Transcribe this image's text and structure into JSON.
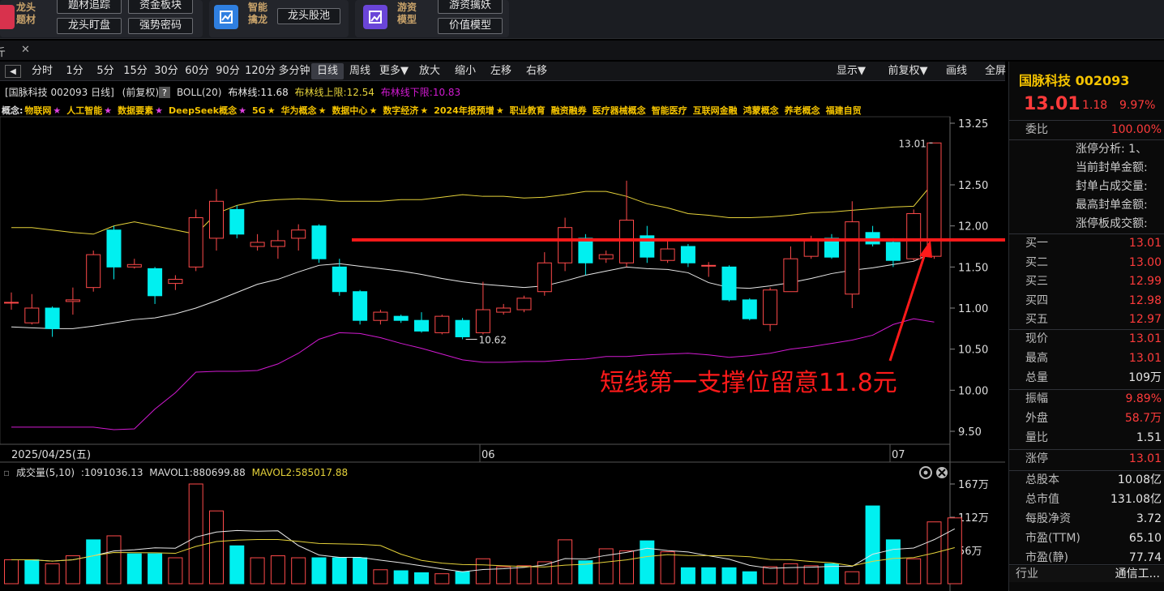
{
  "toolbar": {
    "group1": {
      "label": "龙头题材",
      "buttons": [
        "题材追踪",
        "资金板块",
        "龙头盯盘",
        "强势密码"
      ]
    },
    "group2": {
      "label": "智能擒龙",
      "buttons": [
        "龙头股池"
      ]
    },
    "group3": {
      "label": "游资模型",
      "buttons": [
        "游资擒妖",
        "价值模型"
      ]
    }
  },
  "tab": {
    "title": "斤",
    "close": "✕"
  },
  "periods": {
    "toggle": "◀",
    "items": [
      "分时",
      "1分",
      "5分",
      "15分",
      "30分",
      "60分",
      "90分",
      "120分",
      "多分钟",
      "日线",
      "周线",
      "更多▼",
      "放大",
      "缩小",
      "左移",
      "右移"
    ],
    "active": "日线",
    "right_items": [
      "显示▼",
      "前复权▼",
      "画线",
      "全屏"
    ]
  },
  "chart_header": {
    "stock_label": "[国脉科技 002093 日线]",
    "adjust": "(前复权)",
    "help": "?",
    "indicator": "BOLL(20)",
    "mid": "布林线:11.68",
    "upper": "布林线上限:12.54",
    "lower": "布林线下限:10.83"
  },
  "concepts": {
    "prefix": "概念:",
    "items": [
      {
        "text": "物联网",
        "star": "pink"
      },
      {
        "text": "人工智能",
        "star": "pink"
      },
      {
        "text": "数据要素",
        "star": "pink"
      },
      {
        "text": "DeepSeek概念",
        "star": "pink"
      },
      {
        "text": "5G",
        "star": "gold"
      },
      {
        "text": "华为概念",
        "star": "gold"
      },
      {
        "text": "数据中心",
        "star": "gold"
      },
      {
        "text": "数字经济",
        "star": "gold"
      },
      {
        "text": "2024年报预增",
        "star": "gold"
      },
      {
        "text": "职业教育",
        "star": ""
      },
      {
        "text": "融资融券",
        "star": ""
      },
      {
        "text": "医疗器械概念",
        "star": ""
      },
      {
        "text": "智能医疗",
        "star": ""
      },
      {
        "text": "互联网金融",
        "star": ""
      },
      {
        "text": "鸿蒙概念",
        "star": ""
      },
      {
        "text": "养老概念",
        "star": ""
      },
      {
        "text": "福建自贸",
        "star": ""
      }
    ]
  },
  "price_axis": [
    "13.25",
    "12.50",
    "12.00",
    "11.50",
    "11.00",
    "10.50",
    "10.00",
    "9.50"
  ],
  "date_axis": [
    "2025/04/25(五)",
    "06",
    "07"
  ],
  "annotations": {
    "high_label": "13.01",
    "low_label": "10.62",
    "support_text": "短线第一支撑位留意11.8元"
  },
  "volume_header": {
    "title": "成交量(5,10)",
    "vol": ":1091036.13",
    "mavol1": "MAVOL1:880699.88",
    "mavol2": "MAVOL2:585017.88"
  },
  "volume_axis": [
    "167万",
    "112万",
    "56万"
  ],
  "chart_data": {
    "type": "candlestick",
    "ylim": [
      9.4,
      13.4
    ],
    "support_level": 11.8,
    "candles": [
      {
        "o": 11.07,
        "c": 11.07,
        "h": 11.19,
        "l": 10.98
      },
      {
        "o": 10.82,
        "c": 11.0,
        "h": 11.17,
        "l": 10.8
      },
      {
        "o": 11.0,
        "c": 10.75,
        "h": 11.02,
        "l": 10.65
      },
      {
        "o": 11.08,
        "c": 11.1,
        "h": 11.25,
        "l": 10.92
      },
      {
        "o": 11.25,
        "c": 11.65,
        "h": 11.7,
        "l": 11.2
      },
      {
        "o": 11.95,
        "c": 11.5,
        "h": 12.0,
        "l": 11.35
      },
      {
        "o": 11.5,
        "c": 11.53,
        "h": 11.6,
        "l": 11.48
      },
      {
        "o": 11.48,
        "c": 11.15,
        "h": 11.5,
        "l": 11.05
      },
      {
        "o": 11.3,
        "c": 11.35,
        "h": 11.4,
        "l": 11.22
      },
      {
        "o": 11.5,
        "c": 12.1,
        "h": 12.2,
        "l": 11.45
      },
      {
        "o": 11.85,
        "c": 12.3,
        "h": 12.45,
        "l": 11.7
      },
      {
        "o": 12.2,
        "c": 11.9,
        "h": 12.25,
        "l": 11.85
      },
      {
        "o": 11.75,
        "c": 11.8,
        "h": 11.9,
        "l": 11.7
      },
      {
        "o": 11.75,
        "c": 11.82,
        "h": 11.95,
        "l": 11.6
      },
      {
        "o": 11.85,
        "c": 11.95,
        "h": 12.02,
        "l": 11.7
      },
      {
        "o": 12.0,
        "c": 11.6,
        "h": 12.02,
        "l": 11.55
      },
      {
        "o": 11.5,
        "c": 11.2,
        "h": 11.6,
        "l": 11.15
      },
      {
        "o": 11.2,
        "c": 10.85,
        "h": 11.22,
        "l": 10.8
      },
      {
        "o": 10.85,
        "c": 10.95,
        "h": 10.98,
        "l": 10.8
      },
      {
        "o": 10.9,
        "c": 10.85,
        "h": 10.92,
        "l": 10.82
      },
      {
        "o": 10.85,
        "c": 10.72,
        "h": 10.95,
        "l": 10.7
      },
      {
        "o": 10.7,
        "c": 10.9,
        "h": 10.92,
        "l": 10.68
      },
      {
        "o": 10.85,
        "c": 10.65,
        "h": 10.88,
        "l": 10.62
      },
      {
        "o": 10.7,
        "c": 10.98,
        "h": 11.32,
        "l": 10.68
      },
      {
        "o": 10.95,
        "c": 11.0,
        "h": 11.05,
        "l": 10.92
      },
      {
        "o": 10.98,
        "c": 11.12,
        "h": 11.15,
        "l": 10.95
      },
      {
        "o": 11.2,
        "c": 11.55,
        "h": 11.68,
        "l": 11.15
      },
      {
        "o": 11.55,
        "c": 11.98,
        "h": 12.1,
        "l": 11.45
      },
      {
        "o": 11.85,
        "c": 11.55,
        "h": 11.9,
        "l": 11.4
      },
      {
        "o": 11.6,
        "c": 11.65,
        "h": 11.7,
        "l": 11.55
      },
      {
        "o": 11.55,
        "c": 12.07,
        "h": 12.55,
        "l": 11.5
      },
      {
        "o": 11.88,
        "c": 11.62,
        "h": 12.0,
        "l": 11.55
      },
      {
        "o": 11.58,
        "c": 11.72,
        "h": 11.82,
        "l": 11.55
      },
      {
        "o": 11.75,
        "c": 11.55,
        "h": 11.78,
        "l": 11.5
      },
      {
        "o": 11.52,
        "c": 11.52,
        "h": 11.56,
        "l": 11.38
      },
      {
        "o": 11.5,
        "c": 11.1,
        "h": 11.52,
        "l": 11.08
      },
      {
        "o": 11.1,
        "c": 10.87,
        "h": 11.12,
        "l": 10.85
      },
      {
        "o": 10.8,
        "c": 11.22,
        "h": 11.25,
        "l": 10.72
      },
      {
        "o": 11.2,
        "c": 11.6,
        "h": 11.75,
        "l": 11.2
      },
      {
        "o": 11.63,
        "c": 11.82,
        "h": 11.88,
        "l": 11.6
      },
      {
        "o": 11.85,
        "c": 11.62,
        "h": 11.9,
        "l": 11.6
      },
      {
        "o": 11.17,
        "c": 12.05,
        "h": 12.3,
        "l": 11.0
      },
      {
        "o": 11.92,
        "c": 11.78,
        "h": 12.0,
        "l": 11.75
      },
      {
        "o": 11.8,
        "c": 11.58,
        "h": 11.85,
        "l": 11.5
      },
      {
        "o": 11.6,
        "c": 12.15,
        "h": 12.2,
        "l": 11.58
      },
      {
        "o": 11.63,
        "c": 13.01,
        "h": 13.01,
        "l": 11.6
      }
    ],
    "boll_upper": [
      11.98,
      11.98,
      11.95,
      11.92,
      11.9,
      12.0,
      12.05,
      12.0,
      11.95,
      11.9,
      12.15,
      12.25,
      12.3,
      12.32,
      12.33,
      12.32,
      12.3,
      12.3,
      12.3,
      12.32,
      12.32,
      12.35,
      12.38,
      12.36,
      12.36,
      12.34,
      12.35,
      12.38,
      12.42,
      12.42,
      12.36,
      12.27,
      12.22,
      12.15,
      12.13,
      12.1,
      12.1,
      12.11,
      12.13,
      12.16,
      12.17,
      12.19,
      12.21,
      12.23,
      12.24,
      12.54
    ],
    "boll_mid": [
      10.77,
      10.76,
      10.75,
      10.75,
      10.78,
      10.82,
      10.86,
      10.88,
      10.93,
      11.0,
      11.09,
      11.19,
      11.29,
      11.35,
      11.44,
      11.52,
      11.54,
      11.51,
      11.48,
      11.45,
      11.41,
      11.36,
      11.32,
      11.29,
      11.27,
      11.25,
      11.27,
      11.33,
      11.4,
      11.45,
      11.5,
      11.48,
      11.47,
      11.43,
      11.31,
      11.25,
      11.24,
      11.27,
      11.31,
      11.36,
      11.42,
      11.46,
      11.49,
      11.53,
      11.57,
      11.68
    ],
    "boll_lower": [
      9.55,
      9.55,
      9.55,
      9.55,
      9.55,
      9.52,
      9.53,
      9.77,
      9.97,
      10.22,
      10.23,
      10.23,
      10.24,
      10.32,
      10.45,
      10.62,
      10.7,
      10.69,
      10.64,
      10.57,
      10.51,
      10.44,
      10.37,
      10.34,
      10.34,
      10.35,
      10.35,
      10.37,
      10.38,
      10.41,
      10.41,
      10.43,
      10.44,
      10.45,
      10.43,
      10.4,
      10.42,
      10.45,
      10.5,
      10.53,
      10.57,
      10.61,
      10.67,
      10.8,
      10.87,
      10.83
    ],
    "volume": [
      0.24,
      0.24,
      0.2,
      0.28,
      0.44,
      0.48,
      0.3,
      0.3,
      0.26,
      1.0,
      0.73,
      0.38,
      0.26,
      0.28,
      0.26,
      0.26,
      0.26,
      0.26,
      0.14,
      0.13,
      0.11,
      0.1,
      0.12,
      0.25,
      0.17,
      0.18,
      0.22,
      0.44,
      0.23,
      0.35,
      0.33,
      0.43,
      0.32,
      0.16,
      0.16,
      0.16,
      0.12,
      0.17,
      0.2,
      0.18,
      0.2,
      0.12,
      0.78,
      0.44,
      0.25,
      0.62,
      0.66
    ],
    "volume_up": [
      true,
      false,
      true,
      true,
      false,
      true,
      false,
      false,
      true,
      true,
      true,
      false,
      true,
      true,
      true,
      false,
      false,
      false,
      true,
      false,
      false,
      true,
      false,
      true,
      true,
      true,
      true,
      true,
      false,
      true,
      true,
      false,
      true,
      false,
      false,
      false,
      false,
      true,
      true,
      true,
      false,
      true,
      false,
      false,
      true,
      true,
      true
    ]
  },
  "right_panel": {
    "name": "国脉科技",
    "code": "002093",
    "price": "13.01",
    "change": "1.18",
    "pct": "9.97%",
    "wei_label": "委比",
    "wei_value": "100.00%",
    "limit_rows": [
      "涨停分析: 1、",
      "当前封单金额:",
      "封单占成交量:",
      "最高封单金额:",
      "涨停板成交额:"
    ],
    "bids": [
      {
        "label": "买一",
        "value": "13.01"
      },
      {
        "label": "买二",
        "value": "13.00"
      },
      {
        "label": "买三",
        "value": "12.99"
      },
      {
        "label": "买四",
        "value": "12.98"
      },
      {
        "label": "买五",
        "value": "12.97"
      }
    ],
    "stats1": [
      {
        "label": "现价",
        "value": "13.01",
        "color": "red"
      },
      {
        "label": "最高",
        "value": "13.01",
        "color": "red"
      },
      {
        "label": "总量",
        "value": "109万",
        "color": "white"
      }
    ],
    "stats2": [
      {
        "label": "振幅",
        "value": "9.89%",
        "color": "red"
      },
      {
        "label": "外盘",
        "value": "58.7万",
        "color": "red"
      },
      {
        "label": "量比",
        "value": "1.51",
        "color": "white"
      }
    ],
    "stats3": [
      {
        "label": "涨停",
        "value": "13.01",
        "color": "red"
      }
    ],
    "stats4": [
      {
        "label": "总股本",
        "value": "10.08亿",
        "color": "white"
      },
      {
        "label": "总市值",
        "value": "131.08亿",
        "color": "white"
      },
      {
        "label": "每股净资",
        "value": "3.72",
        "color": "white"
      },
      {
        "label": "市盈(TTM)",
        "value": "65.10",
        "color": "white"
      },
      {
        "label": "市盈(静)",
        "value": "77.74",
        "color": "white"
      }
    ],
    "industry_label": "行业",
    "industry_value": "通信工..."
  },
  "colors": {
    "up": "#ff4a4a",
    "down": "#00f0f0",
    "boll_upper": "#e5d23a",
    "boll_mid": "#e8e8e8",
    "boll_lower": "#d21ad2",
    "support": "#ff1a1a"
  }
}
